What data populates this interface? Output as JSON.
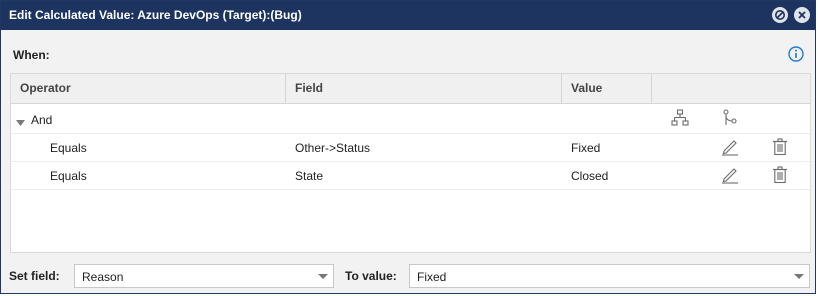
{
  "dialog": {
    "title": "Edit Calculated Value: Azure DevOps (Target):(Bug)",
    "buttons": {
      "minimize_icon": "circle-slash-icon",
      "close_icon": "circle-x-icon"
    }
  },
  "when": {
    "label": "When:",
    "info_icon": "info-icon"
  },
  "table": {
    "headers": {
      "operator": "Operator",
      "field": "Field",
      "value": "Value"
    },
    "group": {
      "operator": "And",
      "add_group_icon": "hierarchy-icon",
      "add_condition_icon": "branch-icon"
    },
    "rows": [
      {
        "operator": "Equals",
        "field": "Other->Status",
        "value": "Fixed"
      },
      {
        "operator": "Equals",
        "field": "State",
        "value": "Closed"
      }
    ]
  },
  "footer": {
    "set_field_label": "Set field:",
    "set_field_value": "Reason",
    "to_value_label": "To value:",
    "to_value_value": "Fixed"
  },
  "colors": {
    "titlebar": "#1d3461",
    "accent": "#1e7bd2"
  }
}
